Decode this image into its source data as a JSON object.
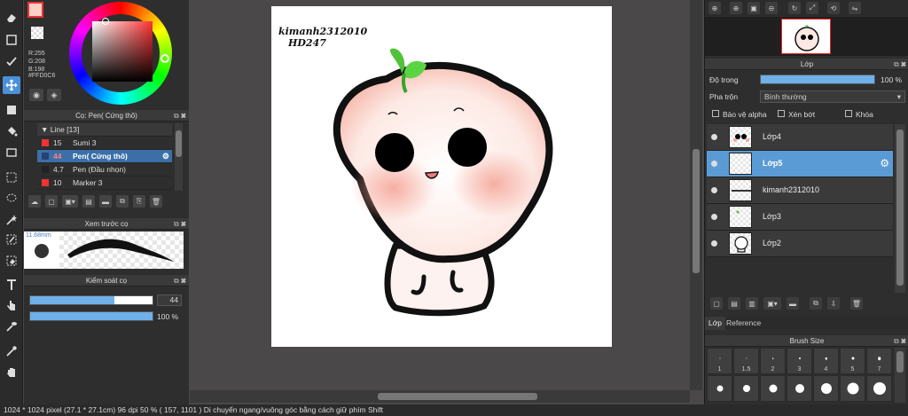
{
  "color": {
    "r_label": "R:255",
    "g_label": "G:208",
    "b_label": "B:198",
    "hex_label": "#FFD0C6",
    "foreground": "#FFD0C6",
    "accent": "#4A90D9"
  },
  "brush_panel": {
    "title": "Cọ: Pen( Cứng thô)",
    "group": "Line [13]",
    "items": [
      {
        "size": "15",
        "name": "Sumi 3",
        "selected": false
      },
      {
        "size": "44",
        "name": "Pen( Cứng thô)",
        "selected": true
      },
      {
        "size": "4.7",
        "name": "Pen (Đầu nhọn)",
        "selected": false
      },
      {
        "size": "10",
        "name": "Marker 3",
        "selected": false
      }
    ]
  },
  "preview_panel": {
    "title": "Xem trước cọ",
    "size_label": "11.68mm"
  },
  "control_panel": {
    "title": "Kiểm soát cọ",
    "size_value": "44",
    "size_fraction": 0.69,
    "opacity_value": "100 %",
    "opacity_fraction": 1.0
  },
  "canvas": {
    "line1": "kimanh2312010",
    "line2": "HD247"
  },
  "status": {
    "text": "1024 * 1024 pixel   (27.1 * 27.1cm)   96 dpi   50 %   ( 157, 1101 )   Di chuyển ngang/vuông góc bằng cách giữ phím Shift"
  },
  "layer_panel": {
    "title": "Lớp",
    "opacity_label": "Độ trong",
    "opacity_value": "100 %",
    "blend_label": "Pha trộn",
    "blend_value": "Bình thường",
    "checkbox_alpha": "Bảo vệ alpha",
    "checkbox_clip": "Xén bớt",
    "checkbox_lock": "Khóa",
    "layers": [
      {
        "name": "Lớp4",
        "selected": false
      },
      {
        "name": "Lớp5",
        "selected": true
      },
      {
        "name": "kimanh2312010",
        "selected": false
      },
      {
        "name": "Lớp3",
        "selected": false
      },
      {
        "name": "Lớp2",
        "selected": false
      }
    ]
  },
  "tabs": {
    "layer_tab": "Lớp",
    "reference_tab": "Reference"
  },
  "brush_size_panel": {
    "title": "Brush Size",
    "labels": [
      "1",
      "1.5",
      "2",
      "3",
      "4",
      "5",
      "7"
    ]
  }
}
